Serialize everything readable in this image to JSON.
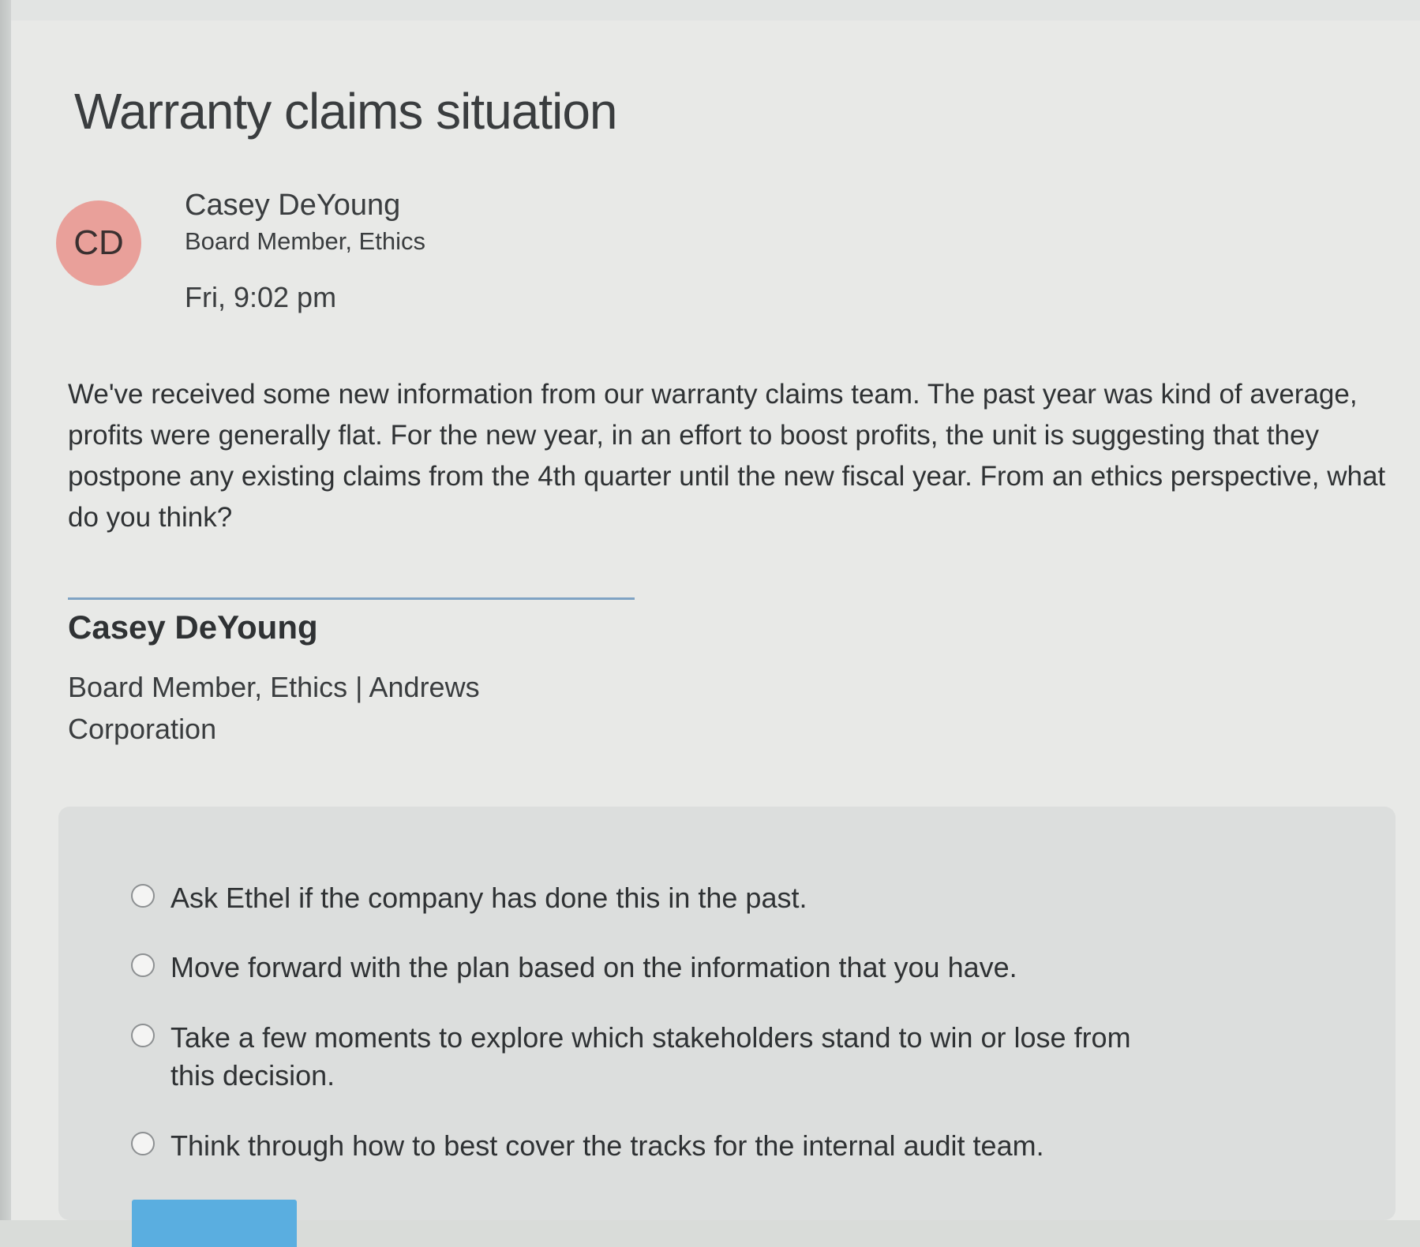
{
  "page": {
    "title": "Warranty claims situation"
  },
  "message": {
    "avatar_initials": "CD",
    "avatar_color": "#e9a09a",
    "sender_name": "Casey DeYoung",
    "sender_role": "Board Member, Ethics",
    "timestamp": "Fri, 9:02 pm",
    "body": "We've received some new information from our warranty claims team. The past year was kind of average, profits were generally flat. For the new year, in an effort to boost profits, the unit is suggesting that they postpone any existing claims from the 4th quarter until the new fiscal year. From an ethics perspective, what do you think?"
  },
  "signature": {
    "name": "Casey DeYoung",
    "title": "Board Member, Ethics | Andrews Corporation"
  },
  "options": [
    {
      "label": "Ask Ethel if the company has done this in the past.",
      "selected": false
    },
    {
      "label": "Move forward with the plan based on the information that you have.",
      "selected": false
    },
    {
      "label": "Take a few moments to explore which stakeholders stand to win or lose from this decision.",
      "selected": false
    },
    {
      "label": "Think through how to best cover the tracks for the internal audit team.",
      "selected": false
    }
  ],
  "colors": {
    "accent": "#5aaee0",
    "divider": "#7fa3c4"
  }
}
